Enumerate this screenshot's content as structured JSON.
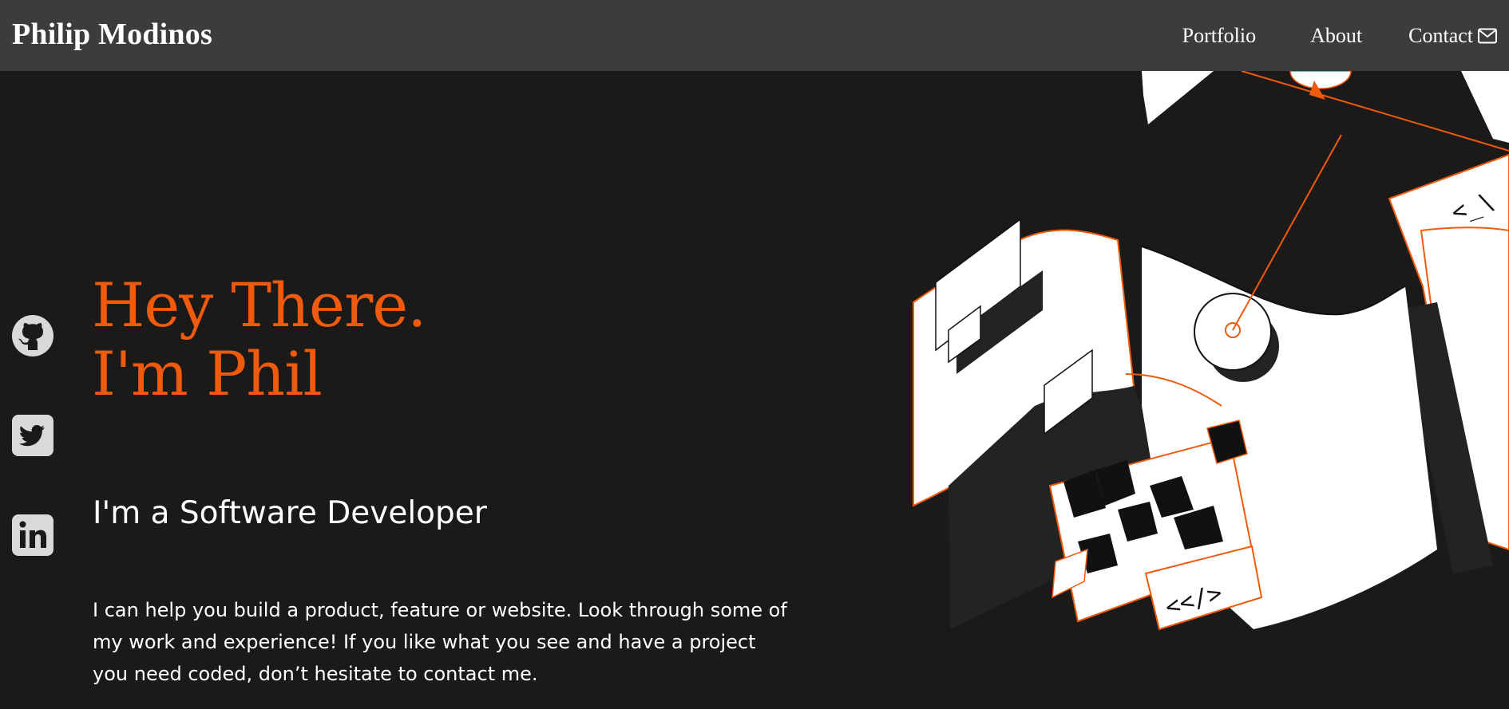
{
  "navbar": {
    "brand": "Philip Modinos",
    "links": [
      {
        "label": "Portfolio"
      },
      {
        "label": "About"
      },
      {
        "label": "Contact"
      }
    ]
  },
  "hero": {
    "headline_line1": "Hey There.",
    "headline_line2": "I'm Phil",
    "subheading": "I'm a Software Developer",
    "intro": "I can help you build a product, feature or website. Look through some of my work and experience! If you like what you see and have a project you need coded, don’t hesitate to contact me.",
    "art_code_tag_1": "<_\\",
    "art_code_tag_2": "<</>"
  },
  "social": [
    {
      "icon": "github-icon"
    },
    {
      "icon": "twitter-icon"
    },
    {
      "icon": "linkedin-icon"
    }
  ],
  "colors": {
    "accent": "#f05a0c",
    "background": "#1c1a19",
    "navbar": "#3d3b3c",
    "text": "#ffffff",
    "icon": "#d9d9d9"
  }
}
